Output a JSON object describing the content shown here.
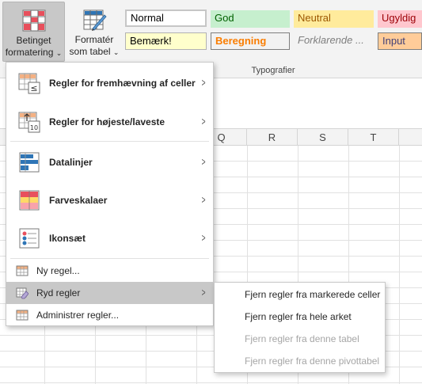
{
  "ribbon": {
    "conditional_formatting": {
      "line1": "Betinget",
      "line2": "formatering",
      "caret": "⌄"
    },
    "format_as_table": {
      "line1": "Formatér",
      "line2": "som tabel",
      "caret": "⌄"
    },
    "styles": {
      "normal": "Normal",
      "god": "God",
      "neutral": "Neutral",
      "ugyldig": "Ugyldig",
      "bemaerk": "Bemærk!",
      "beregning": "Beregning",
      "forklarende": "Forklarende ...",
      "input": "Input"
    },
    "group_label": "Typografier"
  },
  "columns": [
    "Q",
    "R",
    "S",
    "T"
  ],
  "menu": {
    "highlight_rules": "Regler for fremhævning af celler",
    "top_bottom_rules": "Regler for højeste/laveste",
    "data_bars": "Datalinjer",
    "color_scales": "Farveskalaer",
    "icon_sets": "Ikonsæt",
    "new_rule": "Ny regel...",
    "clear_rules": "Ryd regler",
    "manage_rules": "Administrer regler...",
    "icon_text_le": "≤",
    "icon_text_10": "10"
  },
  "submenu": {
    "from_selected": "Fjern regler fra markerede celler",
    "from_sheet": "Fjern regler fra hele arket",
    "from_table": "Fjern regler fra denne tabel",
    "from_pivot": "Fjern regler fra denne pivottabel"
  },
  "colors": {
    "selected_bg": "#c8c8c8",
    "disabled_text": "#a6a6a6",
    "accent_blue": "#2e75b6",
    "accent_red": "#e84f5c"
  }
}
